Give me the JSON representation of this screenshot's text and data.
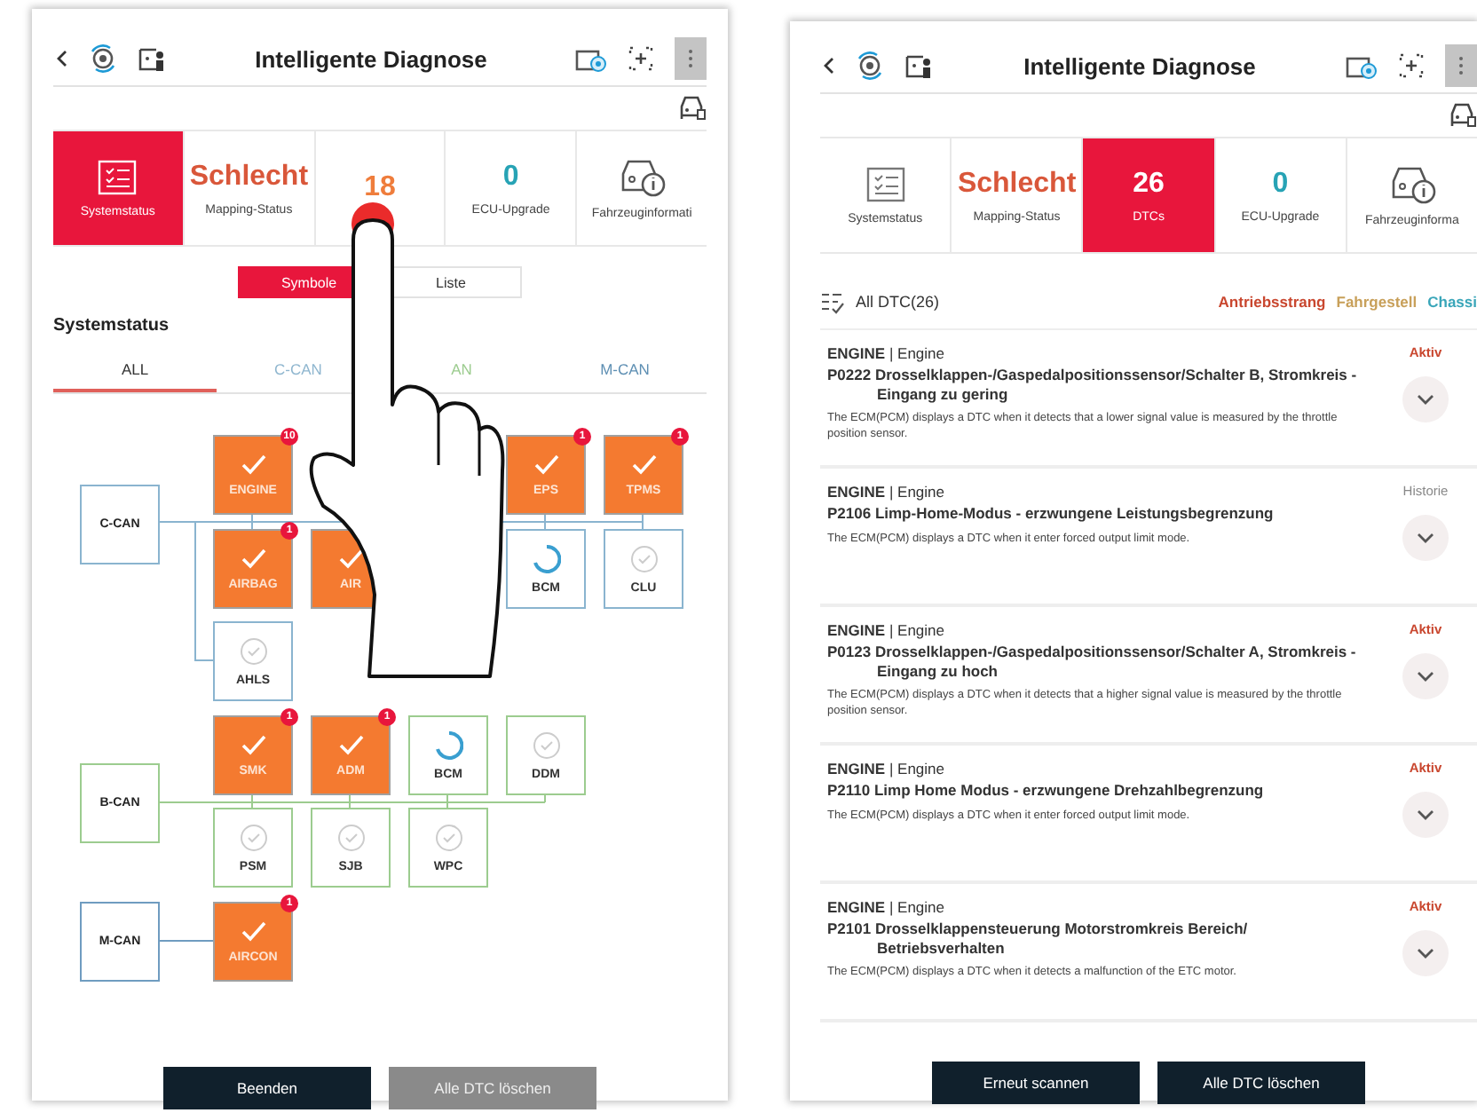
{
  "screens": [
    {
      "kind": "symbols",
      "header": {
        "title": "Intelligente Diagnose"
      },
      "tiles": [
        {
          "kind": "icon",
          "label": "Systemstatus",
          "selected": true
        },
        {
          "kind": "value",
          "value": "Schlecht",
          "label": "Mapping-Status",
          "color": "#d9573a",
          "selected": false
        },
        {
          "kind": "value",
          "value": "18",
          "color": "#ef7d3c",
          "selected": false
        },
        {
          "kind": "value",
          "value": "0",
          "label": "ECU-Upgrade",
          "color": "#27a3b5",
          "selected": false
        },
        {
          "kind": "car",
          "label": "Fahrzeuginformati",
          "selected": false
        }
      ],
      "view_toggle": [
        {
          "label": "Symbole",
          "selected": true
        },
        {
          "label": "Liste",
          "selected": false
        }
      ],
      "section_title": "Systemstatus",
      "bus_tabs": [
        {
          "label": "ALL",
          "selected": true,
          "color": "#333333"
        },
        {
          "label": "C-CAN",
          "selected": false,
          "color": "#8fb6cf"
        },
        {
          "label": "AN",
          "selected": false,
          "color": "#9ccc8f"
        },
        {
          "label": "M-CAN",
          "selected": false,
          "color": "#5e8fb3"
        }
      ],
      "buses": [
        {
          "name": "C-CAN",
          "color": "#8ab4cf",
          "nodes": [
            {
              "label": "ENGINE",
              "kind": "fault",
              "badge": "10"
            },
            {
              "label": "AIRBAG",
              "kind": "fault",
              "badge": "1"
            },
            {
              "label": "AIR",
              "kind": "fault"
            },
            {
              "label": "EPS",
              "kind": "fault",
              "badge": "1"
            },
            {
              "label": "TPMS",
              "kind": "fault",
              "badge": "1"
            },
            {
              "label": "BCM",
              "kind": "loading"
            },
            {
              "label": "CLU",
              "kind": "ok"
            },
            {
              "label": "AHLS",
              "kind": "ok"
            }
          ]
        },
        {
          "name": "B-CAN",
          "color": "#9ccc8f",
          "nodes": [
            {
              "label": "SMK",
              "kind": "fault",
              "badge": "1"
            },
            {
              "label": "ADM",
              "kind": "fault",
              "badge": "1"
            },
            {
              "label": "BCM",
              "kind": "loading"
            },
            {
              "label": "DDM",
              "kind": "ok"
            },
            {
              "label": "PSM",
              "kind": "ok"
            },
            {
              "label": "SJB",
              "kind": "ok"
            },
            {
              "label": "WPC",
              "kind": "ok"
            }
          ]
        },
        {
          "name": "M-CAN",
          "color": "#6f9cc0",
          "nodes": [
            {
              "label": "AIRCON",
              "kind": "fault",
              "badge": "1"
            }
          ]
        }
      ],
      "buttons": [
        {
          "label": "Beenden",
          "disabled": false
        },
        {
          "label": "Alle DTC löschen",
          "disabled": true
        }
      ]
    },
    {
      "kind": "dtc_list",
      "header": {
        "title": "Intelligente Diagnose"
      },
      "tiles": [
        {
          "kind": "icon",
          "label": "Systemstatus",
          "selected": false
        },
        {
          "kind": "value",
          "value": "Schlecht",
          "label": "Mapping-Status",
          "color": "#d9573a",
          "selected": false
        },
        {
          "kind": "value",
          "value": "26",
          "label": "DTCs",
          "selected": true
        },
        {
          "kind": "value",
          "value": "0",
          "label": "ECU-Upgrade",
          "color": "#27a3b5",
          "selected": false
        },
        {
          "kind": "car",
          "label": "Fahrzeuginforma",
          "selected": false
        }
      ],
      "list_header": {
        "title": "All DTC(26)",
        "filters": [
          {
            "label": "Antriebsstrang",
            "color": "#c9472f"
          },
          {
            "label": "Fahrgestell",
            "color": "#c8a05a"
          },
          {
            "label": "Chassi",
            "color": "#3aa6b9"
          }
        ]
      },
      "dtcs": [
        {
          "system": "**ENGINE** | Engine",
          "title": "P0222 Drosselklappen-/Gaspedalpositionssensor/Schalter B, Stromkreis - Eingang zu gering",
          "description": "The ECM(PCM) displays a DTC when it detects that a lower signal value is measured by the throttle position sensor.",
          "status": "Aktiv",
          "active": true
        },
        {
          "system": "**ENGINE** | Engine",
          "title": "P2106 Limp-Home-Modus - erzwungene Leistungsbegrenzung",
          "description": "The ECM(PCM) displays a DTC when it enter forced output limit mode.",
          "status": "Historie",
          "active": false
        },
        {
          "system": "**ENGINE** | Engine",
          "title": "P0123 Drosselklappen-/Gaspedalpositionssensor/Schalter A, Stromkreis - Eingang zu hoch",
          "description": "The ECM(PCM) displays a DTC when it detects that a higher signal value is measured by the throttle position sensor.",
          "status": "Aktiv",
          "active": true
        },
        {
          "system": "**ENGINE** | Engine",
          "title": "P2110 Limp Home Modus - erzwungene Drehzahlbegrenzung",
          "description": "The ECM(PCM) displays a DTC when it enter forced output limit mode.",
          "status": "Aktiv",
          "active": true
        },
        {
          "system": "**ENGINE** | Engine",
          "title": "P2101 Drosselklappensteuerung Motorstromkreis Bereich/ Betriebsverhalten",
          "description": "The ECM(PCM) displays a DTC when it detects a malfunction of the ETC motor.",
          "status": "Aktiv",
          "active": true
        }
      ],
      "buttons": [
        {
          "label": "Erneut scannen",
          "disabled": false
        },
        {
          "label": "Alle DTC löschen",
          "disabled": false
        }
      ]
    }
  ]
}
